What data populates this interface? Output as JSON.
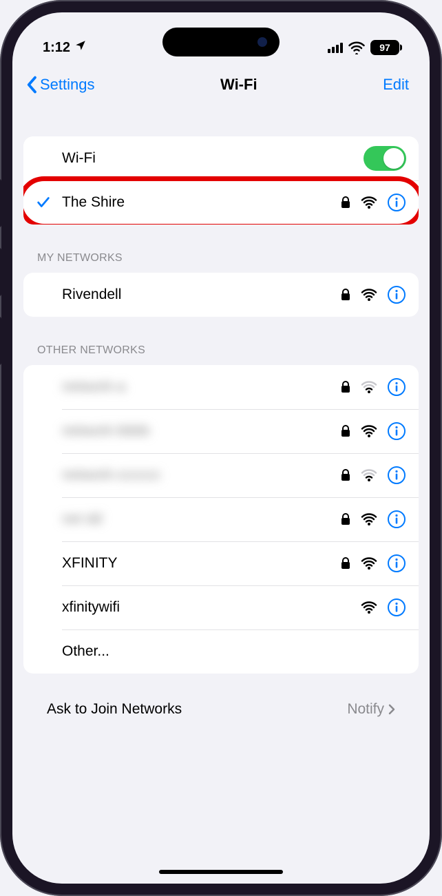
{
  "status": {
    "time": "1:12",
    "battery": "97"
  },
  "nav": {
    "back": "Settings",
    "title": "Wi-Fi",
    "edit": "Edit"
  },
  "wifi": {
    "toggle_label": "Wi-Fi",
    "connected": {
      "name": "The Shire",
      "locked": true
    }
  },
  "sections": {
    "my_header": "My Networks",
    "other_header": "Other Networks"
  },
  "my_networks": [
    {
      "name": "Rivendell",
      "locked": true,
      "signal": "full"
    }
  ],
  "other_networks": [
    {
      "name": "network-a",
      "locked": true,
      "signal": "weak",
      "blurred": true
    },
    {
      "name": "network-bbbb",
      "locked": true,
      "signal": "full",
      "blurred": true
    },
    {
      "name": "network-cccccc",
      "locked": true,
      "signal": "weak",
      "blurred": true
    },
    {
      "name": "net dd",
      "locked": true,
      "signal": "full",
      "blurred": true
    },
    {
      "name": "XFINITY",
      "locked": true,
      "signal": "full",
      "blurred": false
    },
    {
      "name": "xfinitywifi",
      "locked": false,
      "signal": "full",
      "blurred": false
    },
    {
      "name": "Other...",
      "locked": false,
      "signal": "none",
      "blurred": false
    }
  ],
  "footer": {
    "ask": "Ask to Join Networks",
    "value": "Notify"
  },
  "colors": {
    "accent": "#007aff",
    "highlight": "#e30000",
    "toggle_on": "#34c759"
  }
}
